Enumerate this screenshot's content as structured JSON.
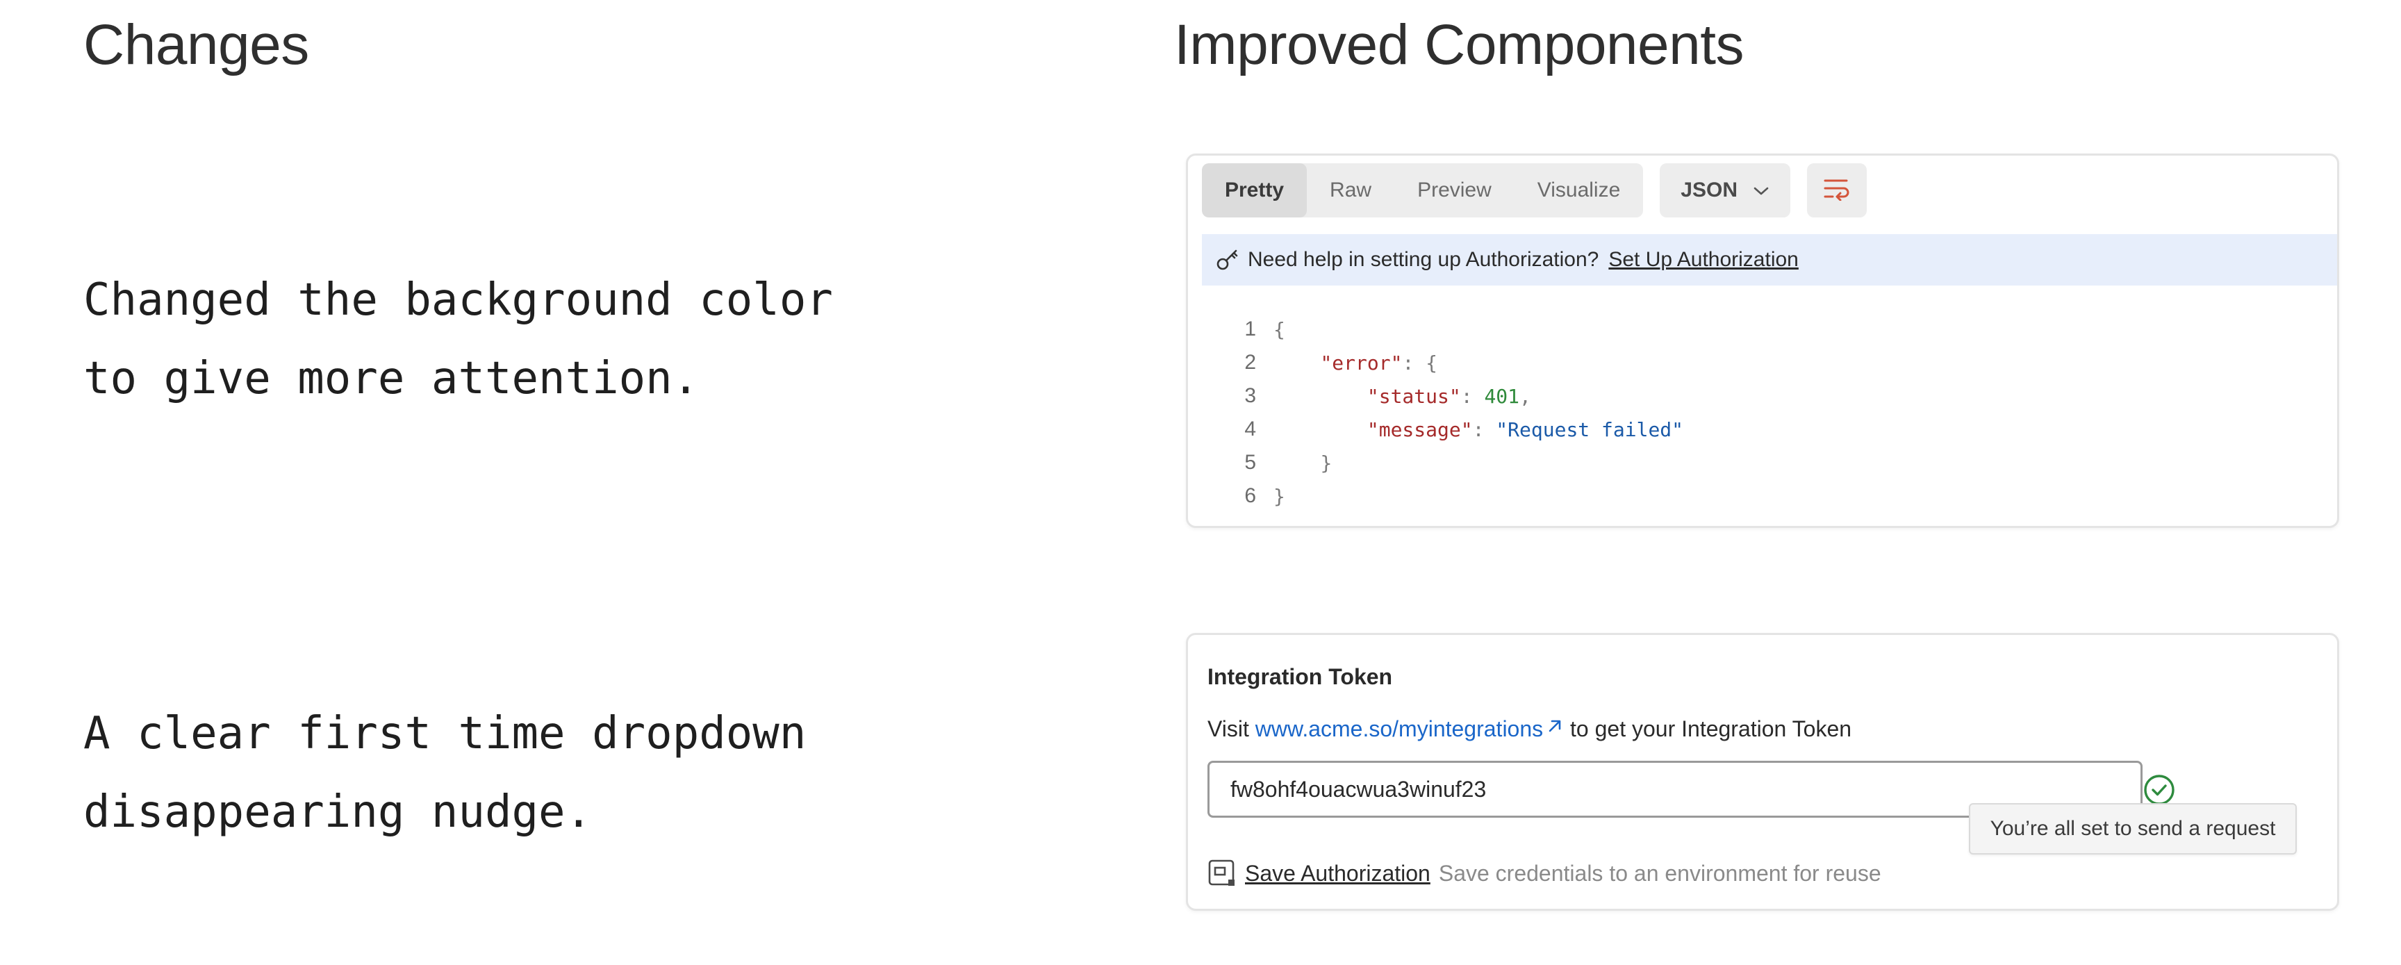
{
  "left": {
    "title": "Changes",
    "items": [
      {
        "text": "Changed the background color\nto give more attention."
      },
      {
        "text": "A clear first time dropdown\ndisappearing nudge."
      }
    ]
  },
  "right": {
    "title": "Improved Components"
  },
  "response_card": {
    "tabs": [
      "Pretty",
      "Raw",
      "Preview",
      "Visualize"
    ],
    "active_tab": "Pretty",
    "format": "JSON",
    "format_icon": "chevron-down-icon",
    "wrap_icon": "wrap-lines-icon",
    "banner": {
      "icon": "key-icon",
      "text": "Need help in setting up Authorization?",
      "link": "Set Up Authorization"
    },
    "code": {
      "line_numbers": [
        "1",
        "2",
        "3",
        "4",
        "5",
        "6"
      ],
      "open_brace": "{",
      "close_brace": "}",
      "error_key": "\"error\"",
      "status_key": "\"status\"",
      "status_value": "401",
      "message_key": "\"message\"",
      "message_value": "\"Request failed\""
    }
  },
  "token_card": {
    "title": "Integration Token",
    "visit_prefix": "Visit ",
    "visit_url": "www.acme.so/myintegrations",
    "visit_suffix": " to get your Integration Token",
    "token_value": "fw8ohf4ouacwua3winuf23",
    "tooltip": "You’re all set to send a request",
    "save_label": "Save Authorization",
    "save_hint": "Save credentials to an environment for reuse",
    "colors": {
      "success": "#2e8b3e",
      "link": "#1a66c9"
    }
  }
}
